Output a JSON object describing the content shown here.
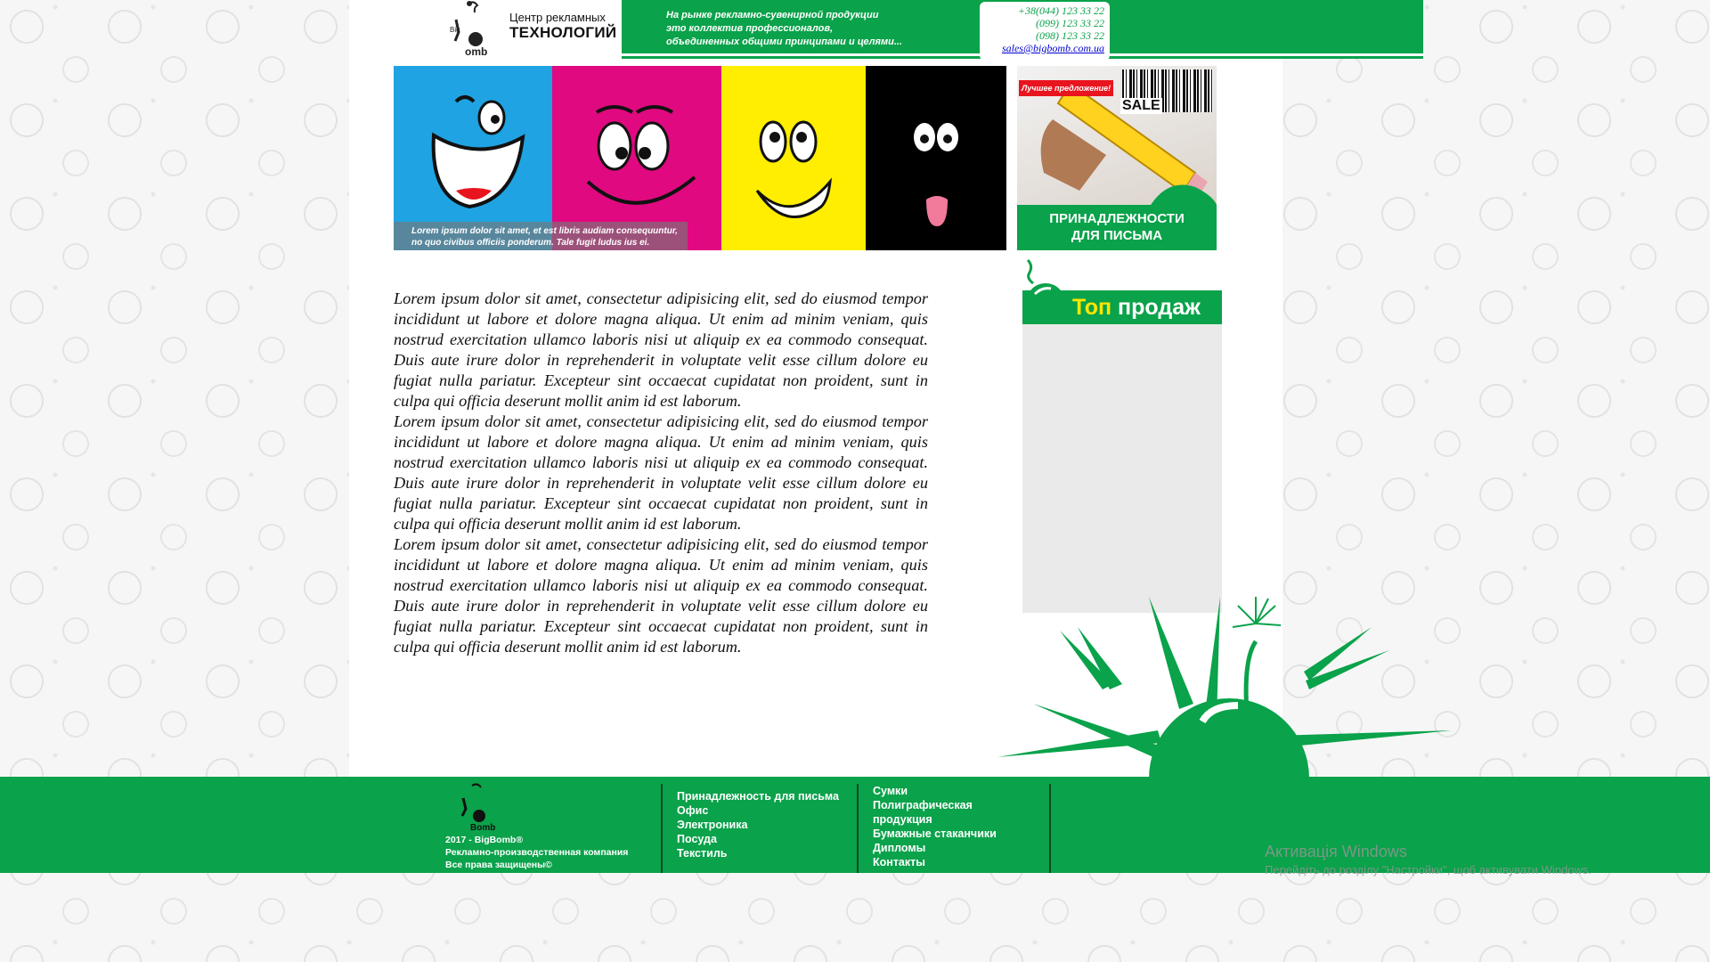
{
  "header": {
    "logo": {
      "line1": "Центр рекламных",
      "line2": "ТЕХНОЛОГИЙ",
      "mark_text": "Big Bomb"
    },
    "tagline": [
      "На рынке рекламно-сувенирной продукции",
      "это коллектив профессионалов,",
      "объединенных общими принципами и целями..."
    ],
    "contacts": {
      "phones": [
        "+38(044) 123 33 22",
        "(099) 123 33 22",
        "(098) 123 33 22"
      ],
      "email": "sales@bigbomb.com.ua"
    }
  },
  "banner": {
    "caption": [
      "Lorem ipsum dolor sit amet, et est libris audiam consequuntur,",
      "no quo civibus officiis ponderum. Tale fugit ludus ius ei."
    ],
    "colors": [
      "#1fa3e2",
      "#e0097f",
      "#ffee00",
      "#000000"
    ]
  },
  "promo": {
    "tag": "Лучшее предложение!",
    "sale": "SALE",
    "label": [
      "ПРИНАДЛЕЖНОСТИ",
      "ДЛЯ ПИСЬМА"
    ]
  },
  "article": {
    "paragraphs": [
      "Lorem ipsum dolor sit amet, consectetur adipisicing elit, sed do eiusmod tempor incididunt ut labore et dolore magna aliqua. Ut enim ad minim veniam, quis nostrud exercitation ullamco laboris nisi ut aliquip ex ea commodo consequat. Duis aute irure dolor in reprehenderit in voluptate velit esse cillum dolore eu fugiat nulla pariatur. Excepteur sint occaecat cupidatat non proident, sunt in culpa qui officia deserunt mollit anim id est laborum.",
      "Lorem ipsum dolor sit amet, consectetur adipisicing elit, sed do eiusmod tempor incididunt ut labore et dolore magna aliqua. Ut enim ad minim veniam, quis nostrud exercitation ullamco laboris nisi ut aliquip ex ea commodo consequat. Duis aute irure dolor in reprehenderit in voluptate velit esse cillum dolore eu fugiat nulla pariatur. Excepteur sint occaecat cupidatat non proident, sunt in culpa qui officia deserunt mollit anim id est laborum.",
      "Lorem ipsum dolor sit amet, consectetur adipisicing elit, sed do eiusmod tempor incididunt ut labore et dolore magna aliqua. Ut enim ad minim veniam, quis nostrud exercitation ullamco laboris nisi ut aliquip ex ea commodo consequat. Duis aute irure dolor in reprehenderit in voluptate velit esse cillum dolore eu fugiat nulla pariatur. Excepteur sint occaecat cupidatat non proident, sunt in culpa qui officia deserunt mollit anim id est laborum."
    ]
  },
  "top_sales": {
    "title_highlight": "Топ",
    "title_rest": "продаж"
  },
  "footer": {
    "copyright": [
      "2017 - BigBomb®",
      "Рекламно-производственная компания",
      "Все права защищены©"
    ],
    "menu_left": [
      "Принадлежность для письма",
      "Офис",
      "Электроника",
      "Посуда",
      "Текстиль"
    ],
    "menu_right": [
      "Сумки",
      "Полиграфическая продукция",
      "Бумажные стаканчики",
      "Дипломы",
      "Контакты"
    ]
  },
  "os_watermark": {
    "title": "Активація Windows",
    "subtitle": "Перейдіть до розділу \"Настройки\", щоб активувати Windows."
  },
  "colors": {
    "brand_green": "#0aa24a",
    "accent_yellow": "#ffe600",
    "link_blue": "#0000cc"
  }
}
